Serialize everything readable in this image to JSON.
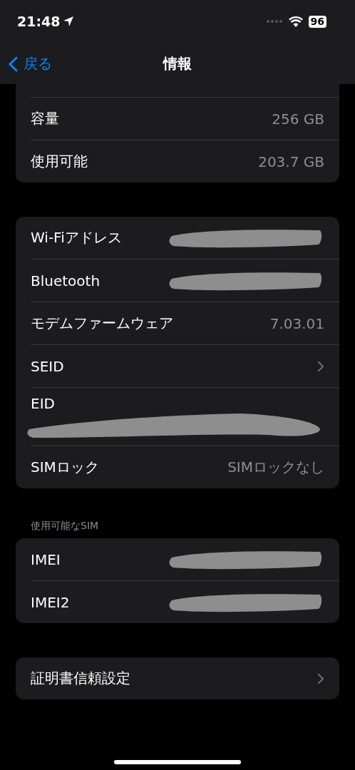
{
  "status_bar": {
    "time": "21:48",
    "battery": "96"
  },
  "nav": {
    "back": "戻る",
    "title": "情報"
  },
  "groups": [
    {
      "partial_top": true,
      "rows": [
        {
          "kind": "value",
          "label": "容量",
          "value": "256 GB"
        },
        {
          "kind": "value",
          "label": "使用可能",
          "value": "203.7 GB"
        }
      ]
    },
    {
      "rows": [
        {
          "kind": "redacted",
          "label": "Wi-Fiアドレス"
        },
        {
          "kind": "redacted",
          "label": "Bluetooth"
        },
        {
          "kind": "value",
          "label": "モデムファームウェア",
          "value": "7.03.01"
        },
        {
          "kind": "chevron",
          "label": "SEID"
        },
        {
          "kind": "redacted_below",
          "label": "EID"
        },
        {
          "kind": "value",
          "label": "SIMロック",
          "value": "SIMロックなし"
        }
      ]
    },
    {
      "header": "使用可能なSIM",
      "rows": [
        {
          "kind": "redacted",
          "label": "IMEI"
        },
        {
          "kind": "redacted",
          "label": "IMEI2"
        }
      ]
    },
    {
      "rows": [
        {
          "kind": "chevron",
          "label": "証明書信頼設定"
        }
      ]
    }
  ]
}
